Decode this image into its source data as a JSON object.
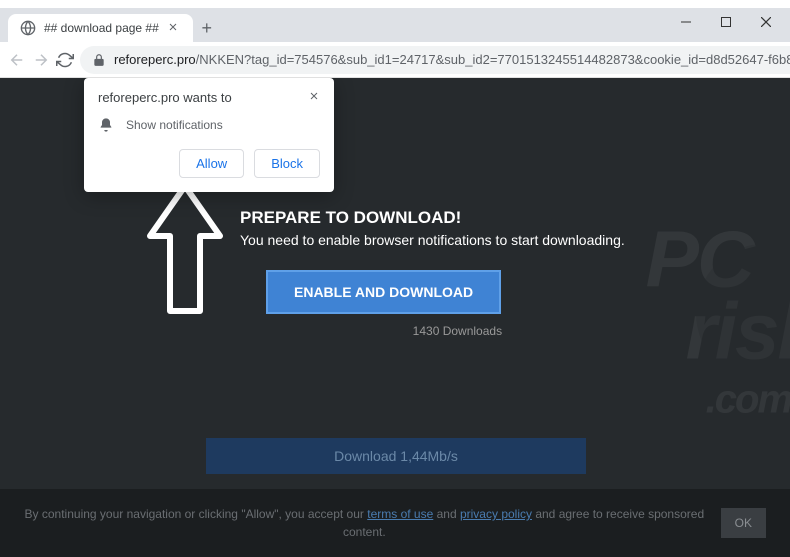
{
  "window": {
    "tab_title": "## download page ##"
  },
  "toolbar": {
    "url_domain": "reforeperc.pro",
    "url_path": "/NKKEN?tag_id=754576&sub_id1=24717&sub_id2=7701513245514482873&cookie_id=d8d52647-f6b8-45b3-89..."
  },
  "permission": {
    "domain_text": "reforeperc.pro wants to",
    "body_text": "Show notifications",
    "allow_label": "Allow",
    "block_label": "Block"
  },
  "page": {
    "prepare_title": "PREPARE TO DOWNLOAD!",
    "subtitle": "You need to enable browser notifications to start downloading.",
    "enable_label": "ENABLE AND DOWNLOAD",
    "downloads_count": "1430 Downloads",
    "download_btn": "Download 1,44Mb/s"
  },
  "cookie": {
    "text_before": "By continuing your navigation or clicking \"Allow\", you accept our ",
    "terms_label": "terms of use",
    "text_mid": " and ",
    "privacy_label": "privacy policy",
    "text_after": " and agree to receive sponsored content.",
    "ok_label": "OK"
  },
  "watermark": {
    "line1": "PC",
    "line2": "risk",
    "line3": ".com"
  }
}
